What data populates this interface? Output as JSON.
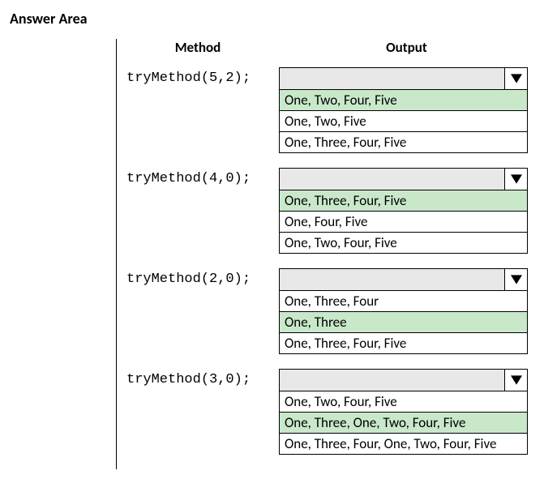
{
  "title": "Answer Area",
  "headers": {
    "method": "Method",
    "output": "Output"
  },
  "questions": [
    {
      "method": "tryMethod(5,2);",
      "options": [
        {
          "text": "One, Two, Four, Five",
          "correct": true
        },
        {
          "text": "One, Two, Five",
          "correct": false
        },
        {
          "text": "One, Three, Four, Five",
          "correct": false
        }
      ]
    },
    {
      "method": "tryMethod(4,0);",
      "options": [
        {
          "text": "One, Three, Four, Five",
          "correct": true
        },
        {
          "text": "One, Four, Five",
          "correct": false
        },
        {
          "text": "One, Two, Four, Five",
          "correct": false
        }
      ]
    },
    {
      "method": "tryMethod(2,0);",
      "options": [
        {
          "text": "One, Three, Four",
          "correct": false
        },
        {
          "text": "One, Three",
          "correct": true
        },
        {
          "text": "One, Three, Four, Five",
          "correct": false
        }
      ]
    },
    {
      "method": "tryMethod(3,0);",
      "options": [
        {
          "text": "One, Two, Four, Five",
          "correct": false
        },
        {
          "text": "One, Three, One, Two, Four, Five",
          "correct": true
        },
        {
          "text": "One, Three, Four, One, Two, Four, Five",
          "correct": false
        }
      ]
    }
  ]
}
